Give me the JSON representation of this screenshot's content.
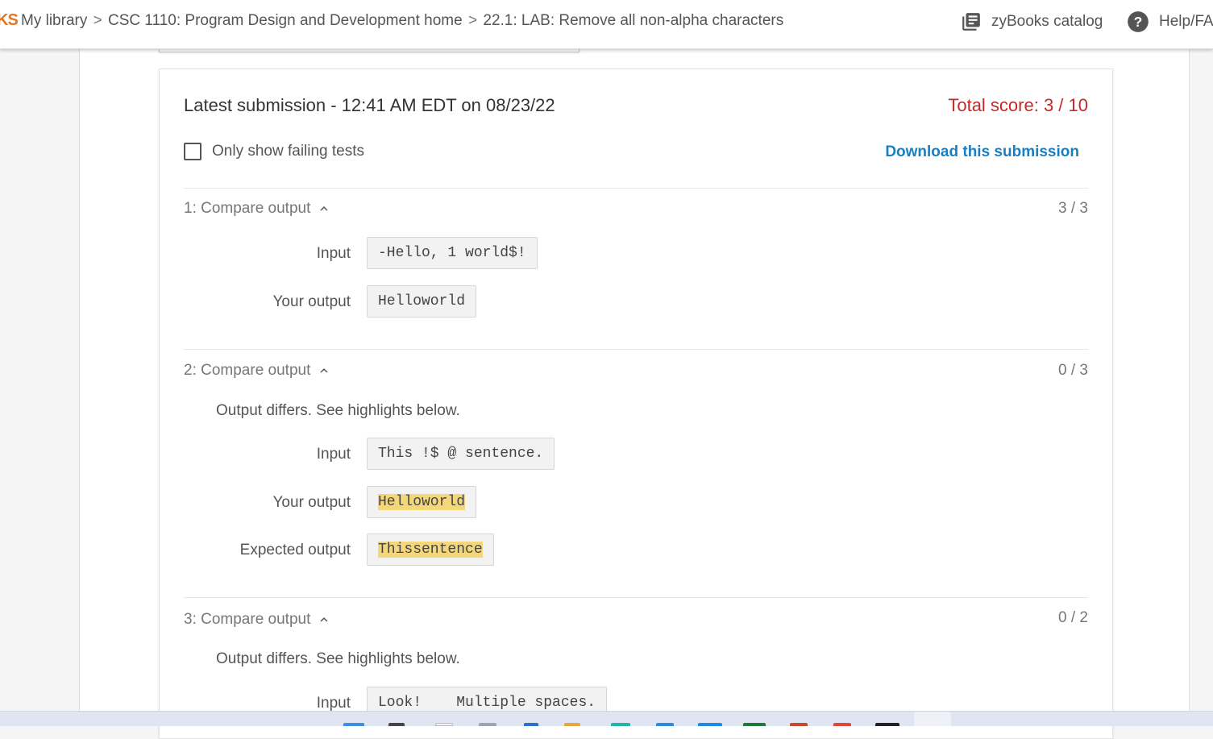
{
  "topbar": {
    "brand_fragment": "KS",
    "breadcrumbs": [
      "My library",
      "CSC 1110: Program Design and Development home",
      "22.1: LAB: Remove all non-alpha characters"
    ],
    "separator": ">",
    "catalog_label": "zyBooks catalog",
    "help_label": "Help/FA"
  },
  "submission": {
    "title": "Latest submission - 12:41 AM EDT on 08/23/22",
    "total_score": "Total score: 3 / 10",
    "failing_label": "Only show failing tests",
    "failing_checked": false,
    "download_label": "Download this submission"
  },
  "tests": [
    {
      "header": "1: Compare output",
      "score": "3 / 3",
      "input_label": "Input",
      "input": "-Hello, 1 world$!",
      "your_output_label": "Your output",
      "your_output": "Helloworld"
    },
    {
      "header": "2: Compare output",
      "score": "0 / 3",
      "message": "Output differs. See highlights below.",
      "input_label": "Input",
      "input": "This !$ @ sentence.",
      "your_output_label": "Your output",
      "your_output": "Helloworld",
      "expected_output_label": "Expected output",
      "expected_output": "Thissentence"
    },
    {
      "header": "3: Compare output",
      "score": "0 / 2",
      "message": "Output differs. See highlights below.",
      "input_label": "Input",
      "input": "Look!    Multiple spaces."
    }
  ],
  "colors": {
    "brand": "#e8741e",
    "score_red": "#c62828",
    "link_blue": "#1a7fc1",
    "highlight": "#f5d77b"
  },
  "icons": [
    "library-books-icon",
    "help-circle-icon",
    "chevron-up-icon"
  ]
}
